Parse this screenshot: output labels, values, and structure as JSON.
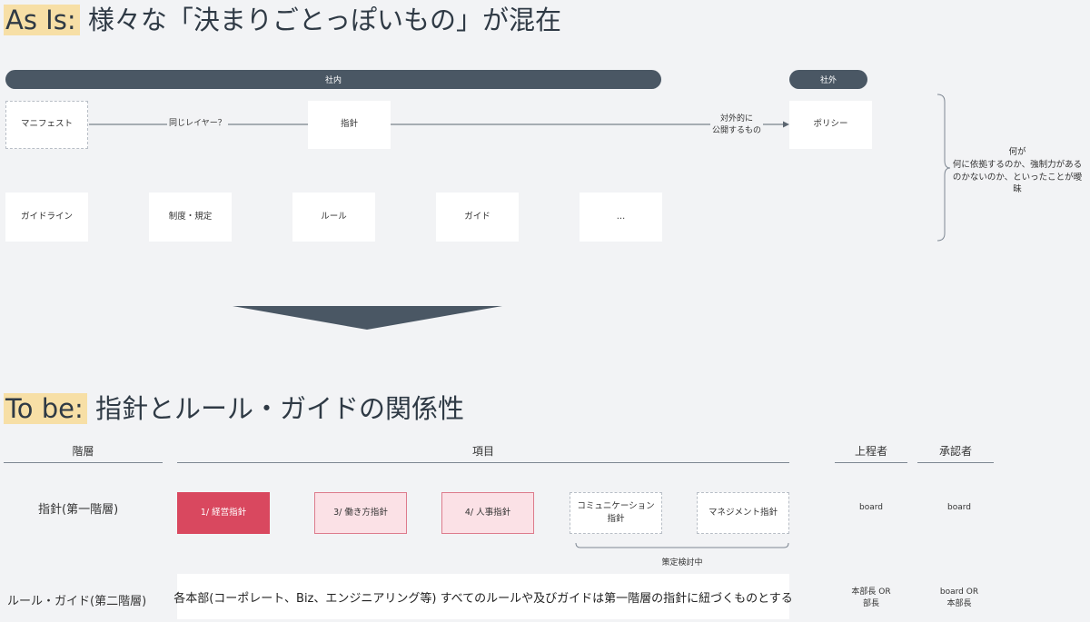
{
  "as_is": {
    "tag": "As Is:",
    "title": "様々な「決まりごとっぽいもの」が混在",
    "groups": {
      "internal": "社内",
      "external": "社外"
    },
    "nodes": {
      "manifest": "マニフェスト",
      "shishin": "指針",
      "policy": "ポリシー",
      "guideline": "ガイドライン",
      "seido": "制度・規定",
      "rule": "ルール",
      "guide": "ガイド",
      "etc": "…"
    },
    "edges": {
      "same_layer": "同じレイヤー？",
      "public_line1": "対外的に",
      "public_line2": "公開するもの"
    },
    "brace_note": {
      "line1": "何が",
      "line2": "何に依拠するのか、強制力がある",
      "line3": "のかないのか、といったことが曖",
      "line4": "昧"
    }
  },
  "to_be": {
    "tag": "To be:",
    "title": "指針とルール・ガイドの関係性",
    "headers": {
      "layer": "階層",
      "items": "項目",
      "owner": "上程者",
      "approver": "承認者"
    },
    "row1": {
      "label": "指針(第一階層)",
      "item1": "1/ 経営指針",
      "item3": "3/ 働き方指針",
      "item4": "4/ 人事指針",
      "comm_line1": "コミュニケーション",
      "comm_line2": "指針",
      "management": "マネジメント指針",
      "under_review": "策定検討中",
      "owner": "board",
      "approver": "board"
    },
    "row2": {
      "label": "ルール・ガイド(第二階層)",
      "description": "各本部(コーポレート、Biz、エンジニアリング等) すべてのルールや及びガイドは第一階層の指針に紐づくものとする",
      "owner_line1": "本部長 OR",
      "owner_line2": "部長",
      "approver_line1": "board OR",
      "approver_line2": "本部長"
    }
  },
  "colors": {
    "bar": "#4a5764",
    "highlight": "#f7dfa6",
    "primary_item": "#d9485f",
    "secondary_item": "#fbe1e6"
  }
}
